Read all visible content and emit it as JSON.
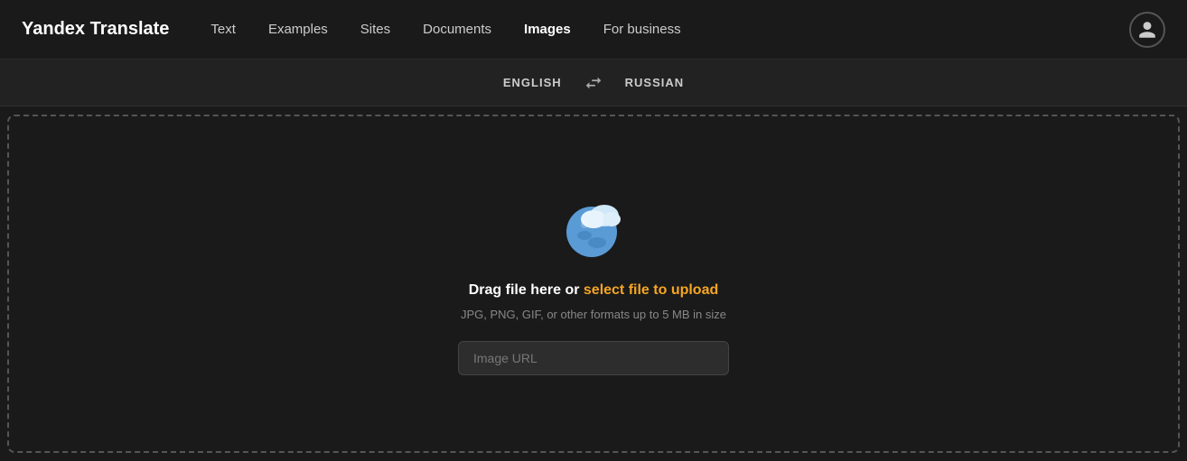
{
  "brand": {
    "name": "Yandex Translate"
  },
  "navbar": {
    "items": [
      {
        "label": "Text",
        "active": false
      },
      {
        "label": "Examples",
        "active": false
      },
      {
        "label": "Sites",
        "active": false
      },
      {
        "label": "Documents",
        "active": false
      },
      {
        "label": "Images",
        "active": true
      },
      {
        "label": "For business",
        "active": false
      }
    ]
  },
  "language_bar": {
    "source_lang": "ENGLISH",
    "target_lang": "RUSSIAN",
    "swap_label": "⇄"
  },
  "drop_zone": {
    "main_text": "Drag file here or ",
    "link_text": "select file to upload",
    "sub_text": "JPG, PNG, GIF, or other formats up to 5 MB in size",
    "input_placeholder": "Image URL"
  }
}
